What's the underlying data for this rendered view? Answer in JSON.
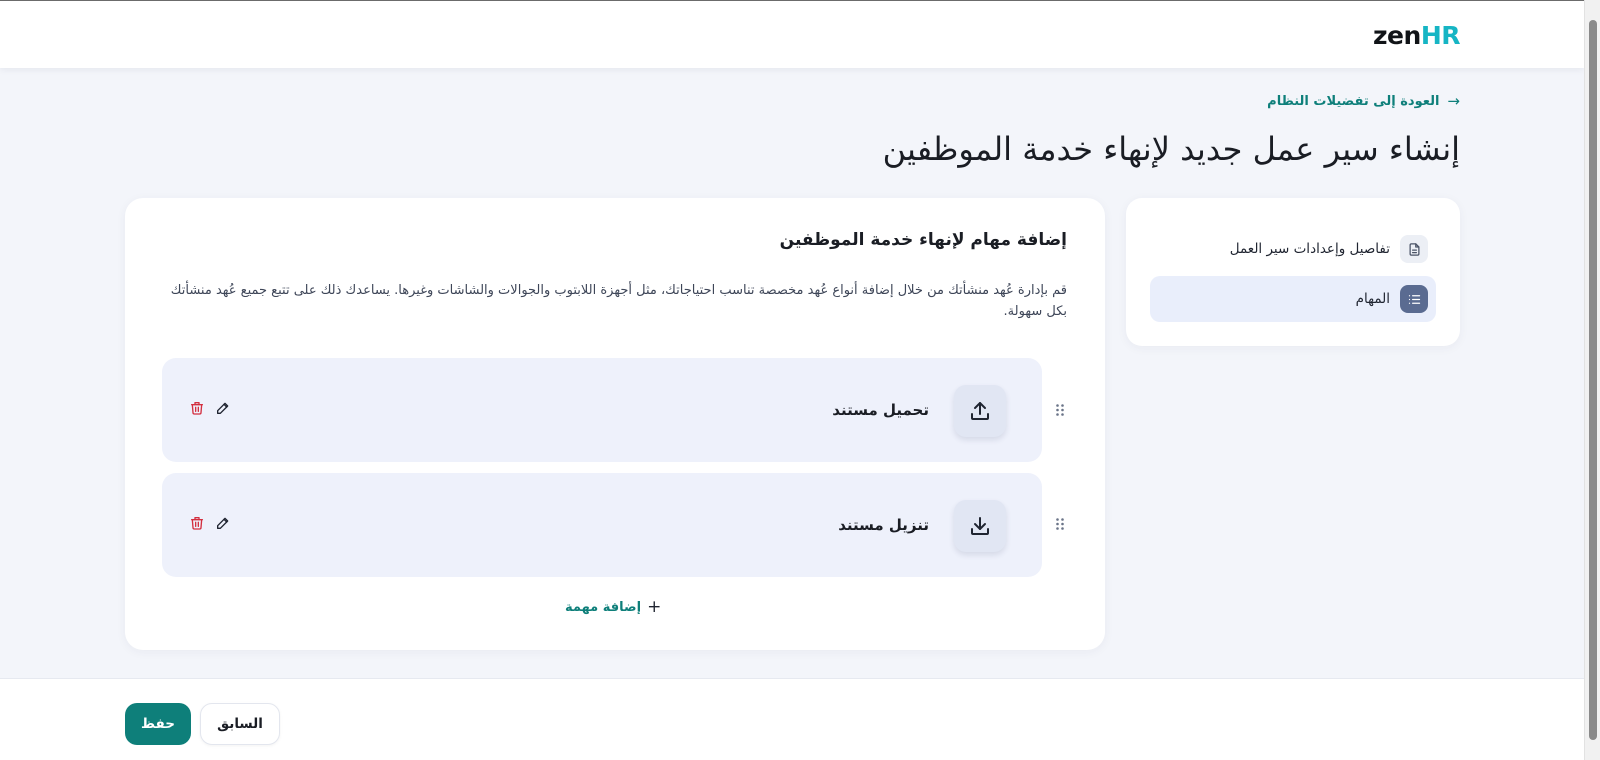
{
  "brand": {
    "logo_zen": "zen",
    "logo_hr": "HR"
  },
  "nav": {
    "back_label": "العودة إلى تفضيلات النظام"
  },
  "page": {
    "title": "إنشاء سير عمل جديد لإنهاء خدمة الموظفين"
  },
  "steps": [
    {
      "label": "تفاصيل وإعدادات سير العمل",
      "icon": "document-icon",
      "active": false
    },
    {
      "label": "المهام",
      "icon": "list-icon",
      "active": true
    }
  ],
  "section": {
    "title": "إضافة مهام لإنهاء خدمة الموظفين",
    "description": "قم بإدارة عُهد منشأتك من خلال إضافة أنواع عُهد مخصصة تناسب احتياجاتك، مثل أجهزة اللابتوب والجوالات والشاشات وغيرها. يساعدك ذلك على تتبع جميع عُهد منشأتك بكل سهولة."
  },
  "tasks": [
    {
      "label": "تحميل مستند",
      "icon": "upload-icon"
    },
    {
      "label": "تنزيل مستند",
      "icon": "download-icon"
    }
  ],
  "add_task_label": "إضافة مهمة",
  "footer": {
    "save_label": "حفظ",
    "previous_label": "السابق"
  },
  "colors": {
    "accent": "#0e7f7a",
    "brand_hr": "#16b5c4",
    "danger": "#d32f3f",
    "active_step_bg": "#e9eefb"
  }
}
